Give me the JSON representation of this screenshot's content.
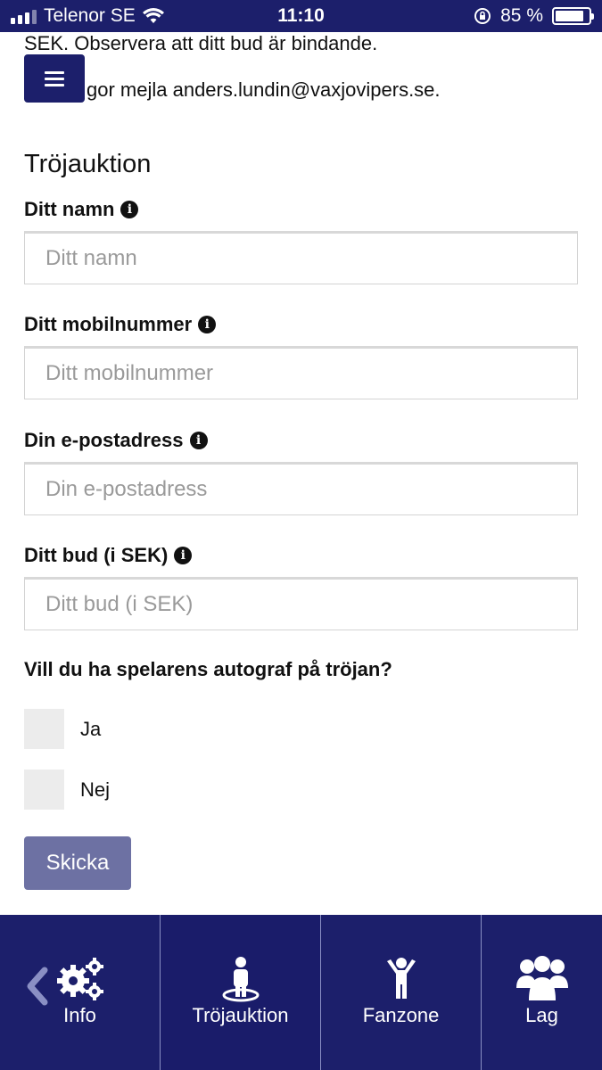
{
  "status_bar": {
    "carrier": "Telenor SE",
    "time": "11:10",
    "battery_percent": "85 %",
    "battery_level": 0.85
  },
  "intro": {
    "line1": "SEK. Observera att ditt bud är bindande.",
    "line2": "gor mejla anders.lundin@vaxjovipers.se."
  },
  "form": {
    "title": "Tröjauktion",
    "fields": [
      {
        "label": "Ditt namn",
        "placeholder": "Ditt namn",
        "value": ""
      },
      {
        "label": "Ditt mobilnummer",
        "placeholder": "Ditt mobilnummer",
        "value": ""
      },
      {
        "label": "Din e-postadress",
        "placeholder": "Din e-postadress",
        "value": ""
      },
      {
        "label": "Ditt bud (i SEK)",
        "placeholder": "Ditt bud (i SEK)",
        "value": ""
      }
    ],
    "info_glyph": "i",
    "question": "Vill du ha spelarens autograf på tröjan?",
    "options": [
      "Ja",
      "Nej"
    ],
    "submit_label": "Skicka"
  },
  "bottom_nav": {
    "items": [
      {
        "label": "Info",
        "icon": "gears-icon"
      },
      {
        "label": "Tröjauktion",
        "icon": "person-pin-icon"
      },
      {
        "label": "Fanzone",
        "icon": "cheering-person-icon"
      },
      {
        "label": "Lag",
        "icon": "group-icon"
      }
    ],
    "active_index": 1
  },
  "colors": {
    "brand": "#1c1f6b",
    "submit": "#6d71a3"
  }
}
